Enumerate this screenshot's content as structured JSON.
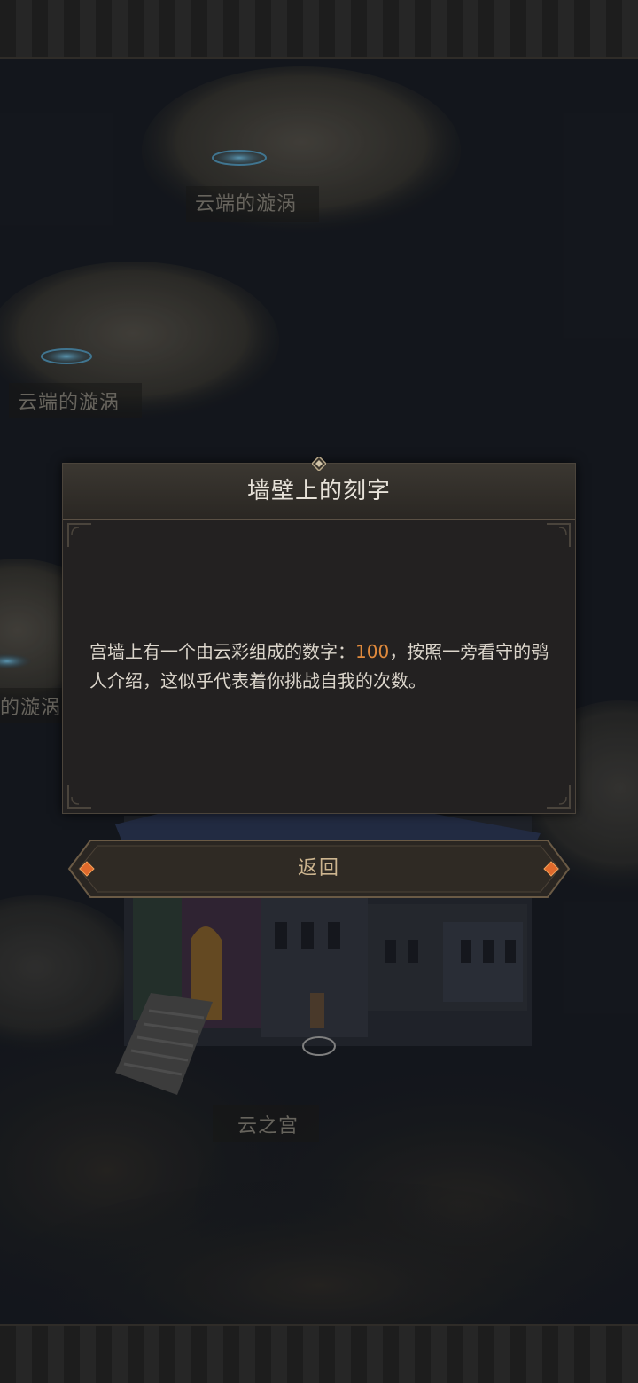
{
  "map": {
    "nodes": [
      {
        "label": "云端的漩涡"
      },
      {
        "label": "云端的漩涡"
      },
      {
        "label": "的漩涡"
      },
      {
        "label": "云之宫"
      }
    ]
  },
  "dialog": {
    "title": "墙壁上的刻字",
    "body_before": "宫墙上有一个由云彩组成的数字：",
    "body_highlight": "100",
    "body_after": "，按照一旁看守的鸮人介绍，这似乎代表着你挑战自我的次数。",
    "highlight_color": "#e18a3c"
  },
  "buttons": {
    "back_label": "返回"
  }
}
